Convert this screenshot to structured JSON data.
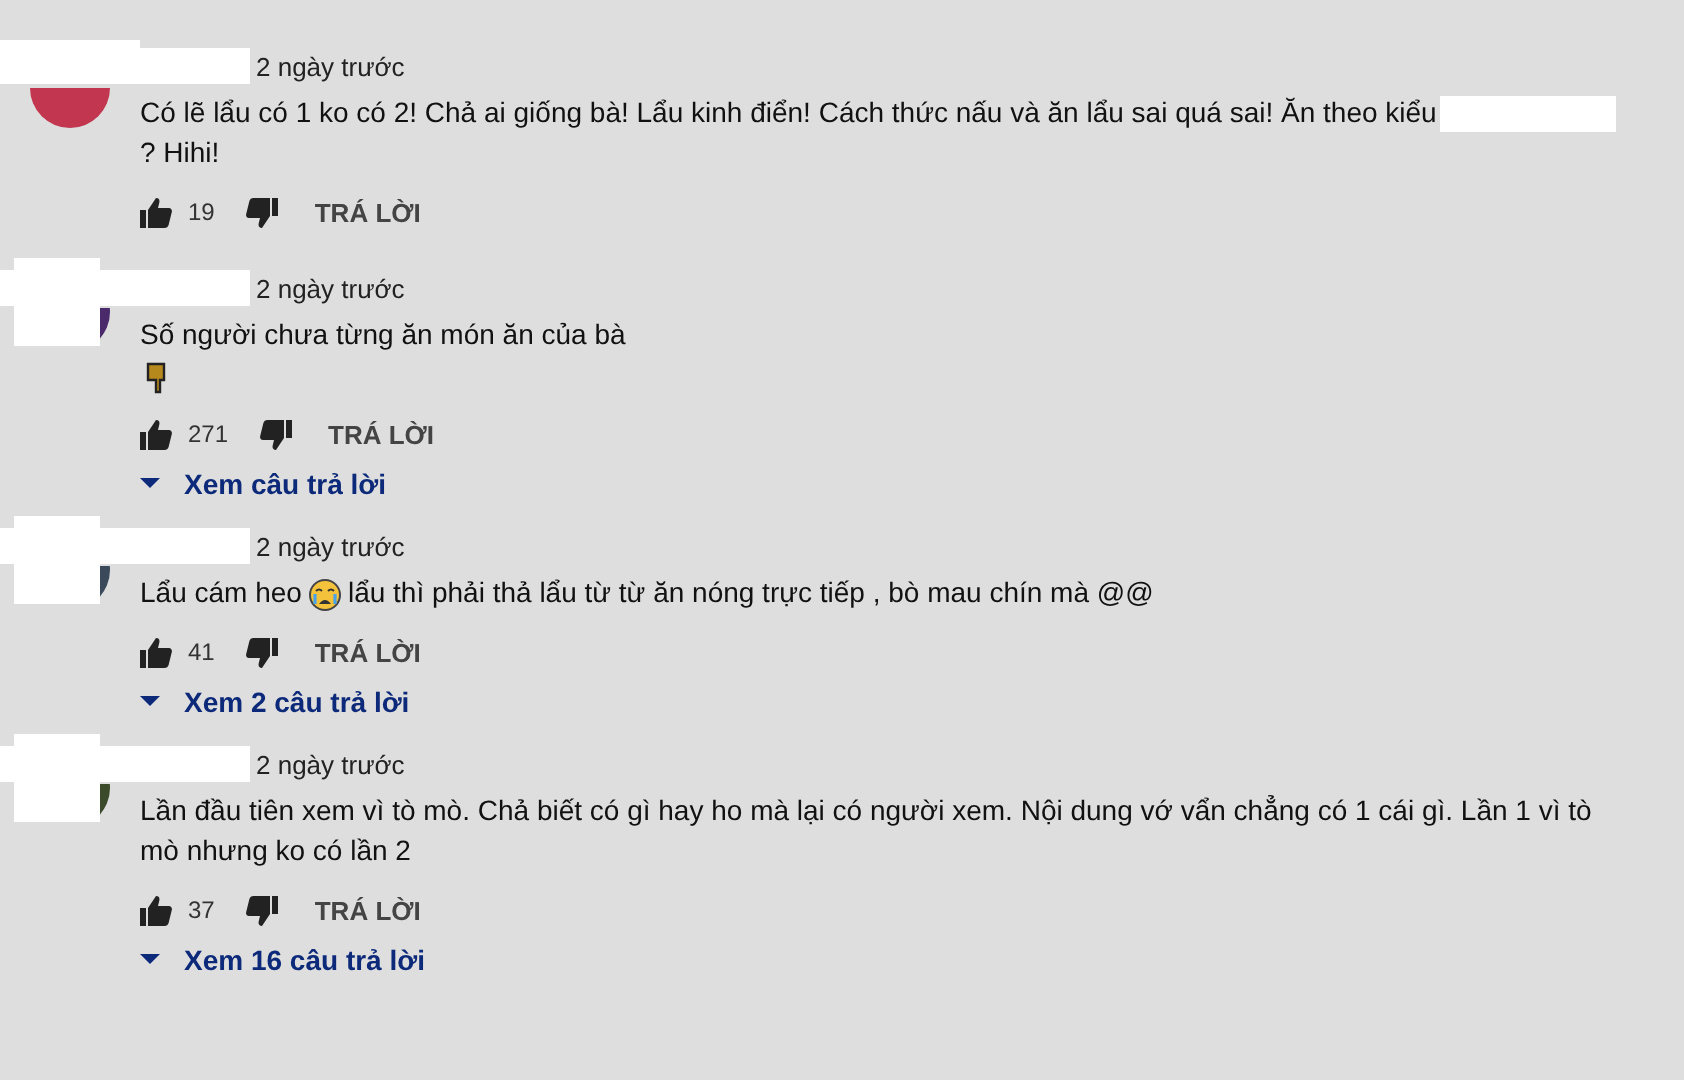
{
  "comments": [
    {
      "color": "#c2364f",
      "time": "2 ngày trước",
      "body": [
        {
          "kind": "text",
          "text": "Có lẽ lẩu có 1 ko có 2! Chả ai giống bà! Lẩu kinh điển! Cách thức nấu và ăn lẩu sai quá sai! Ăn theo kiểu"
        },
        {
          "kind": "redaction"
        },
        {
          "kind": "text",
          "text": "? Hihi!"
        }
      ],
      "likes": "19",
      "reply": "TRÁ LỜI"
    },
    {
      "color": "#4a2a6a",
      "time": "2 ngày trước",
      "body": [
        {
          "kind": "text",
          "text": "Số người chưa từng ăn món ăn của bà"
        },
        {
          "kind": "break"
        },
        {
          "kind": "pointing-hand"
        }
      ],
      "likes": "271",
      "reply": "TRÁ LỜI",
      "view_replies": "Xem câu trả lời"
    },
    {
      "color": "#3a4a5a",
      "time": "2 ngày trước",
      "body": [
        {
          "kind": "text",
          "text": "Lẩu cám heo"
        },
        {
          "kind": "crying-face"
        },
        {
          "kind": "text",
          "text": "lẩu thì phải thả lẩu từ từ ăn nóng trực tiếp , bò mau chín mà @@"
        }
      ],
      "likes": "41",
      "reply": "TRÁ LỜI",
      "view_replies": "Xem 2 câu trả lời"
    },
    {
      "color": "#3b4a2a",
      "time": "2 ngày trước",
      "body": [
        {
          "kind": "text",
          "text": "Lần đầu tiên xem vì tò mò. Chả biết có gì hay ho mà lại có người xem. Nội dung vớ vẩn chẳng có 1 cái gì. Lần 1 vì tò mò nhưng ko có lần 2"
        }
      ],
      "likes": "37",
      "reply": "TRÁ LỜI",
      "view_replies": "Xem 16 câu trả lời"
    }
  ]
}
